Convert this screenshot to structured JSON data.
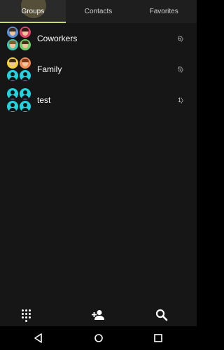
{
  "tabs": [
    {
      "label": "Groups",
      "active": true
    },
    {
      "label": "Contacts",
      "active": false
    },
    {
      "label": "Favorites",
      "active": false
    }
  ],
  "groups": [
    {
      "name": "Coworkers",
      "count": "6",
      "avatars": [
        "face-blue",
        "face-red",
        "face-teal",
        "face-green"
      ]
    },
    {
      "name": "Family",
      "count": "5",
      "avatars": [
        "face-yellow",
        "face-orange",
        "person",
        "person"
      ]
    },
    {
      "name": "test",
      "count": "1",
      "avatars": [
        "person",
        "person",
        "person",
        "person"
      ]
    }
  ],
  "toolbar": {
    "dialpad_icon": "dialpad-icon",
    "add_contact_icon": "add-person-icon",
    "search_icon": "search-icon"
  },
  "navbar": {
    "back_icon": "back-icon",
    "home_icon": "home-icon",
    "recents_icon": "recents-icon"
  },
  "colors": {
    "accent": "#c8d86a",
    "avatar_cyan": "#22d3e0",
    "background": "#161616"
  }
}
